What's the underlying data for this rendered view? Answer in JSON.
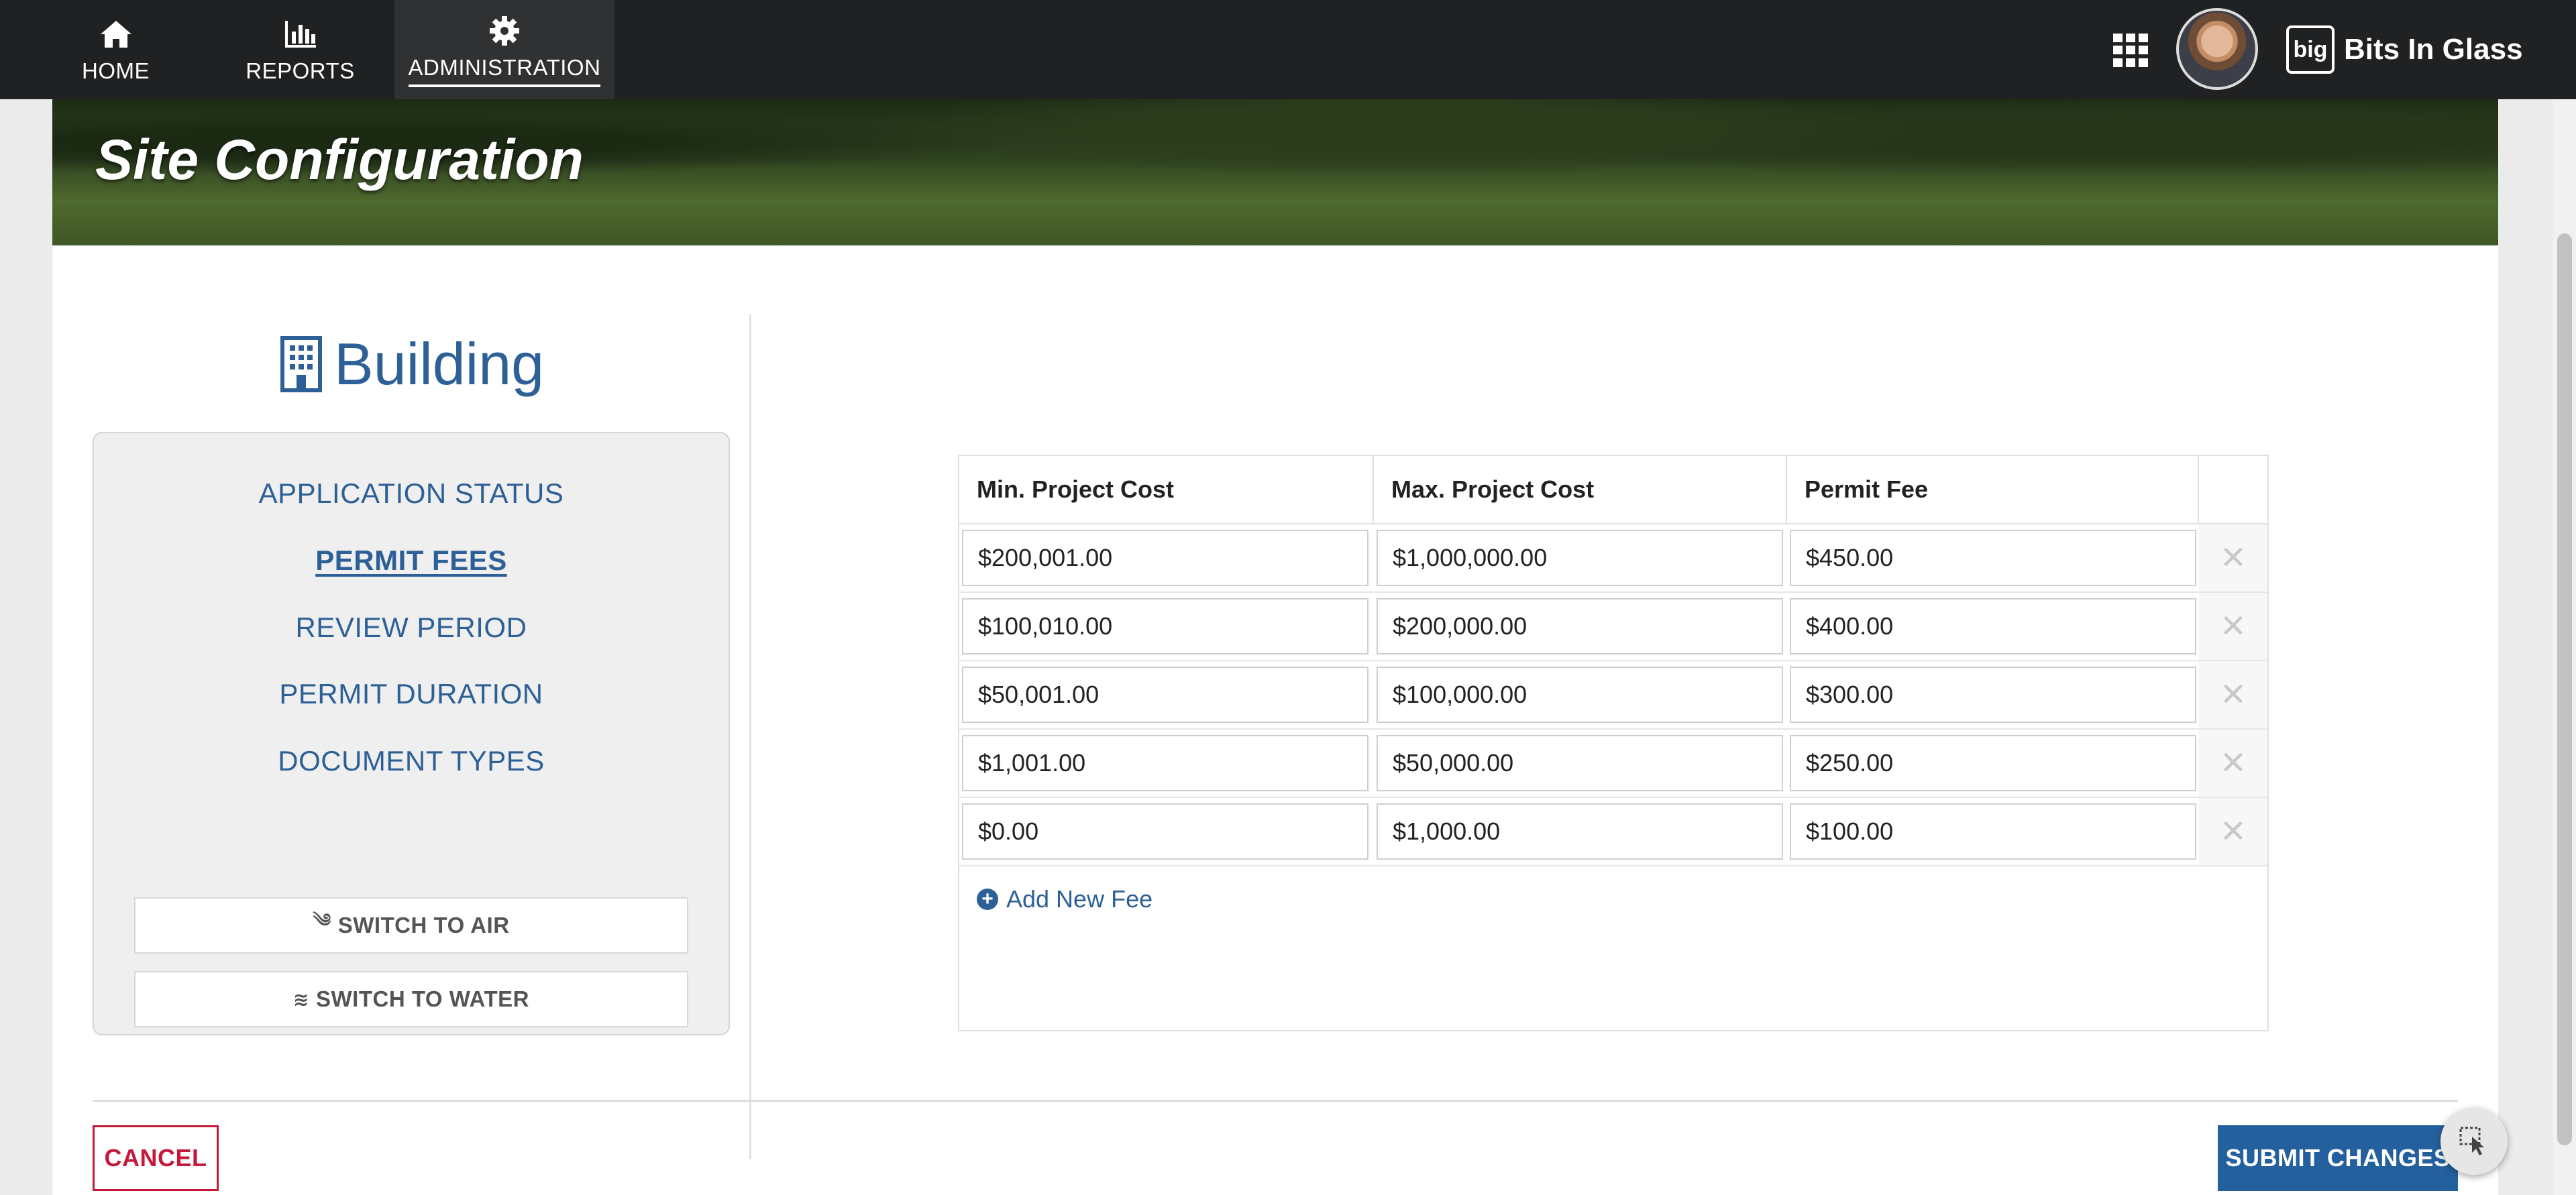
{
  "nav": {
    "items": [
      {
        "label": "HOME",
        "icon": "home-icon"
      },
      {
        "label": "REPORTS",
        "icon": "bar-chart-icon"
      },
      {
        "label": "ADMINISTRATION",
        "icon": "gear-icon",
        "active": true
      }
    ],
    "brand_logo": "big",
    "brand_name": "Bits In Glass"
  },
  "hero": {
    "title": "Site Configuration"
  },
  "section": {
    "heading": "Building",
    "icon": "building-icon",
    "menu": [
      {
        "label": "APPLICATION STATUS",
        "active": false
      },
      {
        "label": "PERMIT FEES",
        "active": true
      },
      {
        "label": "REVIEW PERIOD",
        "active": false
      },
      {
        "label": "PERMIT DURATION",
        "active": false
      },
      {
        "label": "DOCUMENT TYPES",
        "active": false
      }
    ],
    "switch_air": "SWITCH TO AIR",
    "switch_water": "SWITCH TO WATER"
  },
  "fee_table": {
    "columns": [
      "Min. Project Cost",
      "Max. Project Cost",
      "Permit Fee"
    ],
    "rows": [
      {
        "min": "$200,001.00",
        "max": "$1,000,000.00",
        "fee": "$450.00"
      },
      {
        "min": "$100,010.00",
        "max": "$200,000.00",
        "fee": "$400.00"
      },
      {
        "min": "$50,001.00",
        "max": "$100,000.00",
        "fee": "$300.00"
      },
      {
        "min": "$1,001.00",
        "max": "$50,000.00",
        "fee": "$250.00"
      },
      {
        "min": "$0.00",
        "max": "$1,000.00",
        "fee": "$100.00"
      }
    ],
    "delete_glyph": "✕",
    "add_label": "Add New Fee"
  },
  "actions": {
    "cancel": "CANCEL",
    "submit": "SUBMIT CHANGES"
  },
  "colors": {
    "accent": "#2d6096",
    "cancel": "#c4193a",
    "submit": "#24609d",
    "topbar": "#1f2123"
  }
}
